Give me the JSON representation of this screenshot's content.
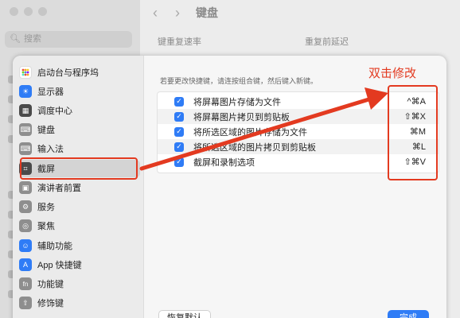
{
  "background": {
    "search_placeholder": "搜索",
    "title": "键盘",
    "label_repeat_rate": "键重复速率",
    "label_delay": "重复前延迟"
  },
  "sidebar": {
    "items": [
      {
        "label": "启动台与程序坞",
        "icon": "launchpad-icon",
        "color": "#ffffff"
      },
      {
        "label": "显示器",
        "icon": "display-icon",
        "color": "#2f7cf6"
      },
      {
        "label": "调度中心",
        "icon": "mission-control-icon",
        "color": "#4a4a4a"
      },
      {
        "label": "键盘",
        "icon": "keyboard-icon",
        "color": "#8e8e8e"
      },
      {
        "label": "输入法",
        "icon": "input-method-icon",
        "color": "#8e8e8e"
      },
      {
        "label": "截屏",
        "icon": "screenshot-icon",
        "color": "#4a4a4a"
      },
      {
        "label": "演讲者前置",
        "icon": "presenter-icon",
        "color": "#8e8e8e"
      },
      {
        "label": "服务",
        "icon": "gear-icon",
        "color": "#8e8e8e"
      },
      {
        "label": "聚焦",
        "icon": "spotlight-icon",
        "color": "#8e8e8e"
      },
      {
        "label": "辅助功能",
        "icon": "accessibility-icon",
        "color": "#2f7cf6"
      },
      {
        "label": "App 快捷键",
        "icon": "app-store-icon",
        "color": "#2f7cf6"
      },
      {
        "label": "功能键",
        "icon": "fn-icon",
        "color": "#8e8e8e"
      },
      {
        "label": "修饰键",
        "icon": "modifier-icon",
        "color": "#8e8e8e"
      }
    ],
    "selected_index": 5
  },
  "content": {
    "hint": "若要更改快捷键，请连按组合键，然后键入新键。",
    "shortcuts": [
      {
        "label": "将屏幕图片存储为文件",
        "key": "^⌘A",
        "checked": true
      },
      {
        "label": "将屏幕图片拷贝到剪贴板",
        "key": "⇧⌘X",
        "checked": true
      },
      {
        "label": "将所选区域的图片存储为文件",
        "key": "⌘M",
        "checked": true
      },
      {
        "label": "将所选区域的图片拷贝到剪贴板",
        "key": "⌘L",
        "checked": true
      },
      {
        "label": "截屏和录制选项",
        "key": "⇧⌘V",
        "checked": true
      }
    ],
    "restore_label": "恢复默认",
    "done_label": "完成"
  },
  "annotation": {
    "text": "双击修改",
    "color": "#e33a20"
  },
  "colors": {
    "accent": "#2f7cf6",
    "annotation": "#e33a20"
  }
}
